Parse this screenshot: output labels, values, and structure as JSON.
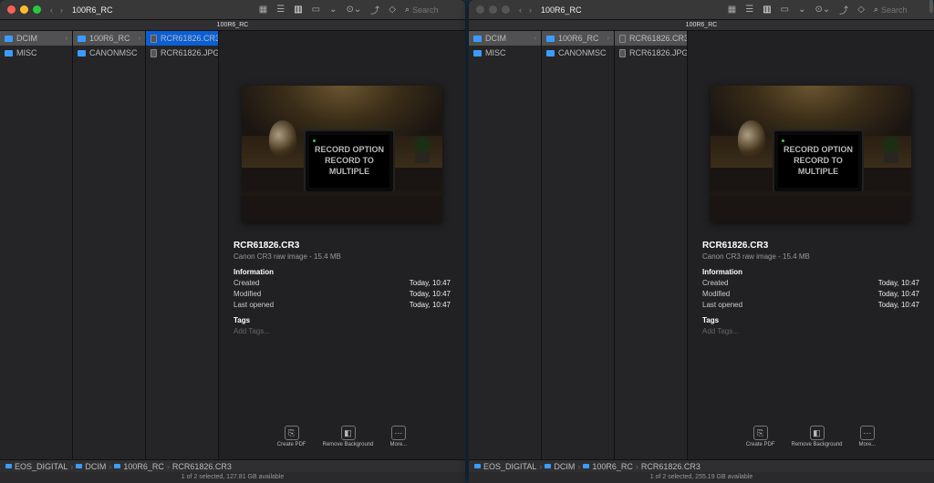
{
  "left": {
    "title": "100R6_RC",
    "subheader": "100R6_RC",
    "search_placeholder": "Search",
    "col1": [
      {
        "name": "DCIM",
        "type": "folder",
        "sel": "graysel",
        "chev": true
      },
      {
        "name": "MISC",
        "type": "folder"
      }
    ],
    "col2": [
      {
        "name": "100R6_RC",
        "type": "folder",
        "sel": "graysel",
        "chev": true
      },
      {
        "name": "CANONMSC",
        "type": "folder"
      }
    ],
    "col3": [
      {
        "name": "RCR61826.CR3",
        "type": "file",
        "sel": "sel"
      },
      {
        "name": "RCR61826.JPG",
        "type": "file"
      }
    ],
    "preview": {
      "filename": "RCR61826.CR3",
      "filetype": "Canon CR3 raw image - 15.4 MB",
      "info_label": "Information",
      "rows": [
        {
          "k": "Created",
          "v": "Today, 10:47"
        },
        {
          "k": "Modified",
          "v": "Today, 10:47"
        },
        {
          "k": "Last opened",
          "v": "Today, 10:47"
        }
      ],
      "tags_label": "Tags",
      "tags_placeholder": "Add Tags...",
      "screen_lines": [
        "RECORD OPTION",
        "RECORD TO",
        "MULTIPLE"
      ]
    },
    "actions": [
      {
        "label": "Create PDF"
      },
      {
        "label": "Remove Background"
      },
      {
        "label": "More..."
      }
    ],
    "path": [
      "EOS_DIGITAL",
      "DCIM",
      "100R6_RC",
      "RCR61826.CR3"
    ],
    "status": "1 of 2 selected, 127.81 GB available"
  },
  "right": {
    "title": "100R6_RC",
    "subheader": "100R6_RC",
    "search_placeholder": "Search",
    "col1": [
      {
        "name": "DCIM",
        "type": "folder",
        "sel": "graysel",
        "chev": true
      },
      {
        "name": "MISC",
        "type": "folder"
      }
    ],
    "col2": [
      {
        "name": "100R6_RC",
        "type": "folder",
        "sel": "graysel",
        "chev": true
      },
      {
        "name": "CANONMSC",
        "type": "folder"
      }
    ],
    "col3": [
      {
        "name": "RCR61826.CR3",
        "type": "file",
        "sel": "graysel"
      },
      {
        "name": "RCR61826.JPG",
        "type": "file"
      }
    ],
    "preview": {
      "filename": "RCR61826.CR3",
      "filetype": "Canon CR3 raw image - 15.4 MB",
      "info_label": "Information",
      "rows": [
        {
          "k": "Created",
          "v": "Today, 10:47"
        },
        {
          "k": "Modified",
          "v": "Today, 10:47"
        },
        {
          "k": "Last opened",
          "v": "Today, 10:47"
        }
      ],
      "tags_label": "Tags",
      "tags_placeholder": "Add Tags...",
      "screen_lines": [
        "RECORD OPTION",
        "RECORD TO",
        "MULTIPLE"
      ]
    },
    "actions": [
      {
        "label": "Create PDF"
      },
      {
        "label": "Remove Background"
      },
      {
        "label": "More..."
      }
    ],
    "path": [
      "EOS_DIGITAL",
      "DCIM",
      "100R6_RC",
      "RCR61826.CR3"
    ],
    "status": "1 of 2 selected, 255.19 GB available"
  }
}
